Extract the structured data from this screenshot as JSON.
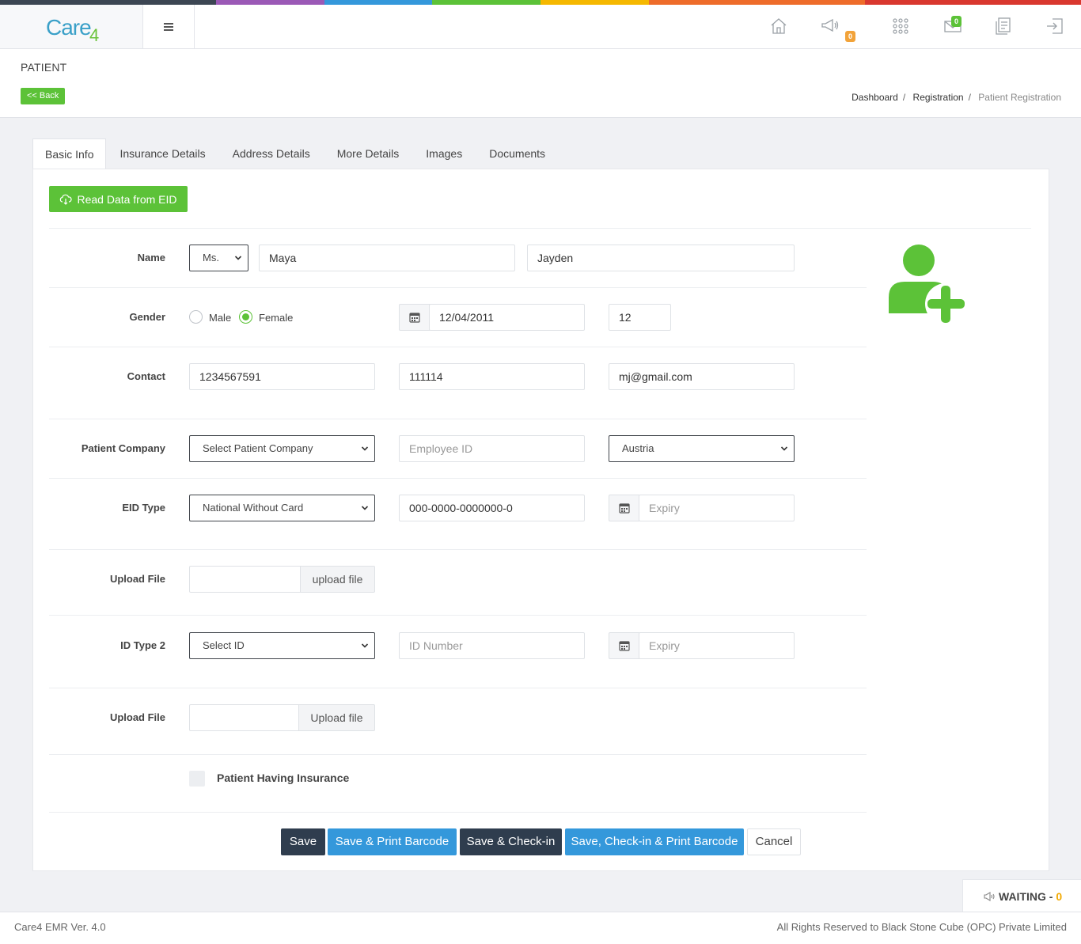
{
  "colors": {
    "top_stripe": [
      "#3c4653",
      "#9b59b6",
      "#3498db",
      "#5cc238",
      "#f5b800",
      "#ee6c2a",
      "#d9382f"
    ],
    "accent_green": "#5cc238",
    "accent_blue": "#3498db",
    "dark_button": "#2f3d4e",
    "badge_orange": "#f2a33a"
  },
  "header": {
    "logo": "Care4",
    "menu_icon": "hamburger-icon",
    "icons": [
      {
        "name": "home-icon"
      },
      {
        "name": "megaphone-icon",
        "badge": "0"
      },
      {
        "name": "apps-grid-icon"
      },
      {
        "name": "mail-icon",
        "badge": "0"
      },
      {
        "name": "reports-icon"
      },
      {
        "name": "logout-icon"
      }
    ]
  },
  "page": {
    "title": "PATIENT",
    "back_label": "<< Back",
    "breadcrumb": [
      "Dashboard",
      "Registration",
      "Patient Registration"
    ]
  },
  "tabs": [
    "Basic Info",
    "Insurance Details",
    "Address Details",
    "More Details",
    "Images",
    "Documents"
  ],
  "form": {
    "read_eid_label": "Read Data from EID",
    "name": {
      "label": "Name",
      "title": "Ms.",
      "first": "Maya",
      "last": "Jayden"
    },
    "gender": {
      "label": "Gender",
      "male": "Male",
      "female": "Female",
      "selected": "Female",
      "dob": "12/04/2011",
      "age": "12"
    },
    "contact": {
      "label": "Contact",
      "phone": "1234567591",
      "alt": "111114",
      "email": "mj@gmail.com"
    },
    "company": {
      "label": "Patient Company",
      "company": "Select Patient Company",
      "employee_placeholder": "Employee ID",
      "country": "Austria"
    },
    "eid": {
      "label": "EID Type",
      "type": "National Without Card",
      "number": "000-0000-0000000-0",
      "expiry_placeholder": "Expiry"
    },
    "upload1": {
      "label": "Upload File",
      "button": "upload file"
    },
    "id2": {
      "label": "ID Type 2",
      "type": "Select ID",
      "number_placeholder": "ID Number",
      "expiry_placeholder": "Expiry"
    },
    "upload2": {
      "label": "Upload File",
      "button": "Upload file"
    },
    "insurance_checkbox": "Patient Having Insurance"
  },
  "actions": {
    "save": "Save",
    "save_print": "Save & Print Barcode",
    "save_checkin": "Save & Check-in",
    "save_checkin_print": "Save, Check-in & Print Barcode",
    "cancel": "Cancel"
  },
  "waiting": {
    "label": "WAITING - ",
    "count": "0"
  },
  "footer": {
    "left": "Care4 EMR Ver. 4.0",
    "right": "All Rights Reserved to Black Stone Cube (OPC) Private Limited"
  }
}
